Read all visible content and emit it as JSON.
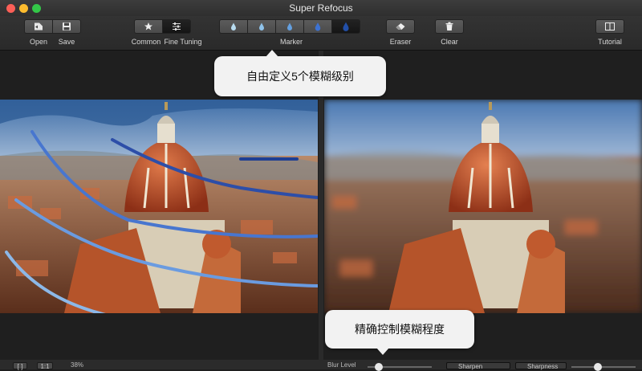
{
  "window": {
    "title": "Super Refocus"
  },
  "toolbar": {
    "open_label": "Open",
    "save_label": "Save",
    "common_label": "Common",
    "fine_tuning_label": "Fine Tuning",
    "marker_label": "Marker",
    "eraser_label": "Eraser",
    "clear_label": "Clear",
    "tutorial_label": "Tutorial",
    "marker_levels": 5,
    "active_marker_level": 5
  },
  "callouts": {
    "marker_levels": "自由定义5个模糊级别",
    "blur_control": "精确控制模糊程度"
  },
  "bottom": {
    "fit_glyph": "[ ]",
    "actual_glyph": "1:1",
    "zoom": "38%",
    "blur_level_label": "Blur Level",
    "sharpen_label": "Sharpen",
    "sharpness_label": "Sharpness"
  },
  "colors": {
    "marker_stroke_1": "#a8d0e8",
    "marker_stroke_2": "#7fb3e0",
    "marker_stroke_3": "#5b8fd6",
    "marker_stroke_4": "#3a63c4",
    "marker_stroke_5": "#1f3f93"
  }
}
